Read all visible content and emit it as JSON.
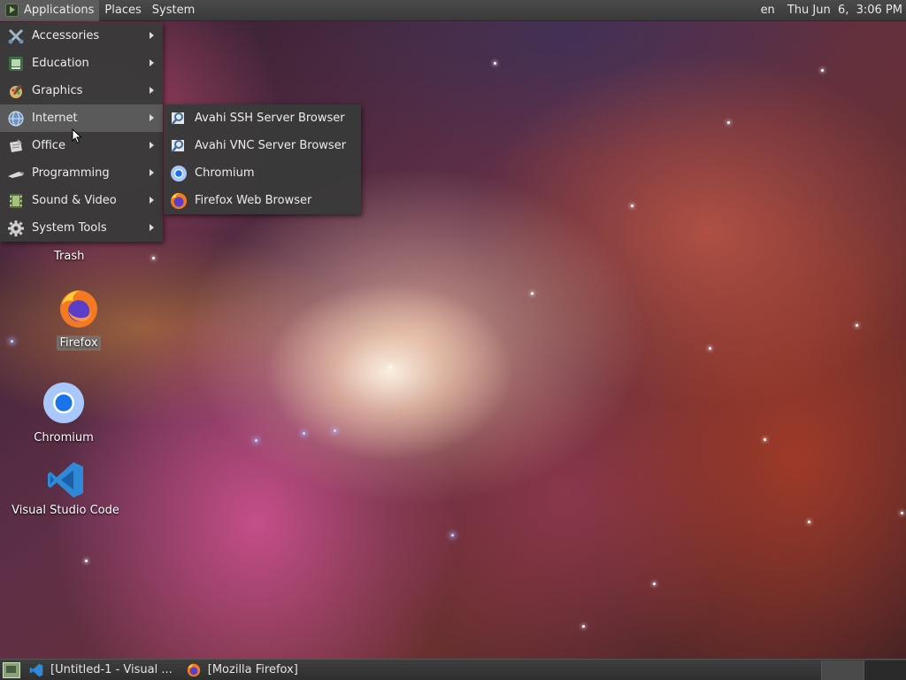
{
  "top_panel": {
    "menus": [
      {
        "label": "Applications",
        "active": true
      },
      {
        "label": "Places",
        "active": false
      },
      {
        "label": "System",
        "active": false
      }
    ],
    "keyboard_layout": "en",
    "clock": "Thu Jun  6,  3:06 PM"
  },
  "applications_menu": {
    "items": [
      {
        "label": "Accessories",
        "icon": "accessories-icon",
        "has_submenu": true,
        "highlighted": false
      },
      {
        "label": "Education",
        "icon": "education-icon",
        "has_submenu": true,
        "highlighted": false
      },
      {
        "label": "Graphics",
        "icon": "graphics-icon",
        "has_submenu": true,
        "highlighted": false
      },
      {
        "label": "Internet",
        "icon": "internet-globe-icon",
        "has_submenu": true,
        "highlighted": true
      },
      {
        "label": "Office",
        "icon": "office-icon",
        "has_submenu": true,
        "highlighted": false
      },
      {
        "label": "Programming",
        "icon": "programming-icon",
        "has_submenu": true,
        "highlighted": false
      },
      {
        "label": "Sound & Video",
        "icon": "sound-video-icon",
        "has_submenu": true,
        "highlighted": false
      },
      {
        "label": "System Tools",
        "icon": "system-tools-gear-icon",
        "has_submenu": true,
        "highlighted": false
      }
    ]
  },
  "internet_submenu": {
    "items": [
      {
        "label": "Avahi SSH Server Browser",
        "icon": "avahi-ssh-icon"
      },
      {
        "label": "Avahi VNC Server Browser",
        "icon": "avahi-vnc-icon"
      },
      {
        "label": "Chromium",
        "icon": "chromium-icon"
      },
      {
        "label": "Firefox Web Browser",
        "icon": "firefox-icon"
      }
    ]
  },
  "desktop_icons": [
    {
      "label": "Trash",
      "icon": "trash-icon",
      "selected": false
    },
    {
      "label": "Firefox",
      "icon": "firefox-icon",
      "selected": true
    },
    {
      "label": "Chromium",
      "icon": "chromium-icon",
      "selected": false
    },
    {
      "label": "Visual Studio Code",
      "icon": "vscode-icon",
      "selected": false
    }
  ],
  "taskbar": {
    "tasks": [
      {
        "label": "[Untitled-1 - Visual ...",
        "icon": "vscode-icon"
      },
      {
        "label": "[Mozilla Firefox]",
        "icon": "firefox-icon"
      }
    ],
    "workspaces": 4,
    "current_workspace": 1
  },
  "colors": {
    "panel": "#3a3a3a",
    "menu_bg": "#3a3a3a",
    "menu_highlight": "#5a5a5a",
    "vscode_blue": "#2e8ad8",
    "chromium_blue": "#4a90e2",
    "firefox_orange": "#f37a23"
  }
}
